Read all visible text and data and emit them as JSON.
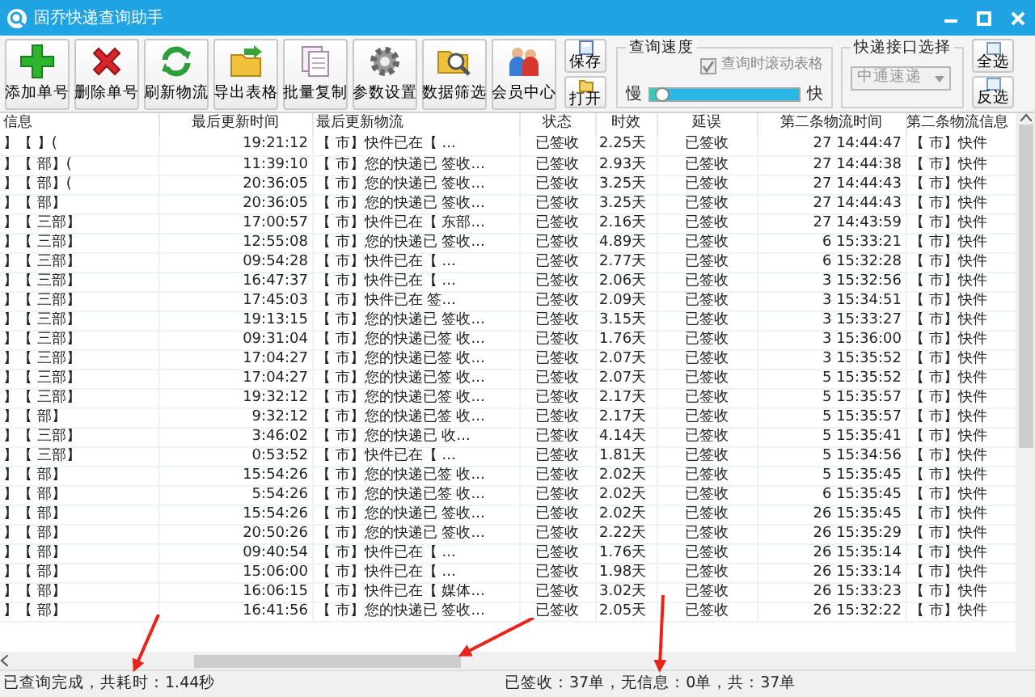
{
  "window": {
    "title": "固乔快递查询助手"
  },
  "toolbar": {
    "buttons": [
      {
        "label": "添加单号",
        "kind": "add"
      },
      {
        "label": "删除单号",
        "kind": "delete"
      },
      {
        "label": "刷新物流",
        "kind": "refresh"
      },
      {
        "label": "导出表格",
        "kind": "export"
      },
      {
        "label": "批量复制",
        "kind": "copy"
      },
      {
        "label": "参数设置",
        "kind": "settings"
      },
      {
        "label": "数据筛选",
        "kind": "filter"
      },
      {
        "label": "会员中心",
        "kind": "members"
      }
    ],
    "side_buttons": [
      {
        "label": "保存",
        "kind": "save"
      },
      {
        "label": "打开",
        "kind": "open"
      }
    ]
  },
  "speed": {
    "title": "查询速度",
    "scroll_checkbox": {
      "label": "查询时滚动表格",
      "checked": true,
      "disabled": true
    },
    "slow_label": "慢",
    "fast_label": "快",
    "level": 0.05
  },
  "interface": {
    "title": "快递接口选择",
    "value": "中通速递",
    "disabled": true
  },
  "select_buttons": [
    {
      "label": "全选"
    },
    {
      "label": "反选"
    }
  ],
  "table": {
    "columns": [
      "信息",
      "最后更新时间",
      "最后更新物流",
      "状态",
      "时效",
      "延误",
      "第二条物流时间",
      "第二条物流信息"
    ],
    "rows": [
      {
        "cells": [
          "】【 】(",
          "19:21:12",
          "【 市】快件已在【 ...",
          "已签收",
          "2.25天",
          "已签收",
          "27 14:44:47",
          "【 市】快件"
        ]
      },
      {
        "cells": [
          "】【 部】(",
          "11:39:10",
          "【 市】您的快递已 签收...",
          "已签收",
          "2.93天",
          "已签收",
          "27 14:44:38",
          "【 市】快件"
        ]
      },
      {
        "cells": [
          "】【 部】(",
          "20:36:05",
          "【 市】您的快递已 签收...",
          "已签收",
          "3.25天",
          "已签收",
          "27 14:44:43",
          "【 市】快件"
        ]
      },
      {
        "cells": [
          "】【 部】",
          "20:36:05",
          "【 市】您的快递已 签收...",
          "已签收",
          "3.25天",
          "已签收",
          "27 14:44:43",
          "【 市】快件"
        ]
      },
      {
        "cells": [
          "】【 三部】",
          "17:00:57",
          "【 市】快件已在【 东部...",
          "已签收",
          "2.16天",
          "已签收",
          "27 14:43:59",
          "【 市】快件"
        ]
      },
      {
        "cells": [
          "】【 三部】",
          "12:55:08",
          "【 市】您的快递已 签收...",
          "已签收",
          "4.89天",
          "已签收",
          "6 15:33:21",
          "【 市】快件"
        ]
      },
      {
        "cells": [
          "】【 三部】",
          "09:54:28",
          "【 市】快件已在【 ...",
          "已签收",
          "2.77天",
          "已签收",
          "6 15:32:28",
          "【 市】快件"
        ]
      },
      {
        "cells": [
          "】【 三部】",
          "16:47:37",
          "【 市】快件已在【 ...",
          "已签收",
          "2.06天",
          "已签收",
          "3 15:32:56",
          "【 市】快件"
        ]
      },
      {
        "cells": [
          "】【 三部】",
          "17:45:03",
          "【 市】快件已在 签...",
          "已签收",
          "2.09天",
          "已签收",
          "3 15:34:51",
          "【 市】快件"
        ]
      },
      {
        "cells": [
          "】【 三部】",
          "19:13:15",
          "【 市】您的快递已 签收...",
          "已签收",
          "3.15天",
          "已签收",
          "3 15:33:27",
          "【 市】快件"
        ]
      },
      {
        "cells": [
          "】【 三部】",
          "09:31:04",
          "【 市】您的快递已签 收...",
          "已签收",
          "1.76天",
          "已签收",
          "3 15:36:00",
          "【 市】快件"
        ]
      },
      {
        "cells": [
          "】【 三部】",
          "17:04:27",
          "【 市】您的快递已签 收...",
          "已签收",
          "2.07天",
          "已签收",
          "3 15:35:52",
          "【 市】快件"
        ]
      },
      {
        "cells": [
          "】【 三部】",
          "17:04:27",
          "【 市】您的快递已签 收...",
          "已签收",
          "2.07天",
          "已签收",
          "5 15:35:52",
          "【 市】快件"
        ]
      },
      {
        "cells": [
          "】【 三部】",
          "19:32:12",
          "【 市】您的快递已签 收...",
          "已签收",
          "2.17天",
          "已签收",
          "5 15:35:57",
          "【 市】快件"
        ]
      },
      {
        "cells": [
          "】【 部】",
          "9:32:12",
          "【 市】您的快递已签 收...",
          "已签收",
          "2.17天",
          "已签收",
          "5 15:35:57",
          "【 市】快件"
        ]
      },
      {
        "cells": [
          "】【 三部】",
          "3:46:02",
          "【 市】您的快递已 收...",
          "已签收",
          "4.14天",
          "已签收",
          "5 15:35:41",
          "【 市】快件"
        ]
      },
      {
        "cells": [
          "】【 三部】",
          "0:53:52",
          "【 市】快件已在【 ...",
          "已签收",
          "1.81天",
          "已签收",
          "5 15:34:56",
          "【 市】快件"
        ]
      },
      {
        "cells": [
          "】【 部】",
          "15:54:26",
          "【 市】您的快递已签 收...",
          "已签收",
          "2.02天",
          "已签收",
          "5 15:35:45",
          "【 市】快件"
        ]
      },
      {
        "cells": [
          "】【 部】",
          "5:54:26",
          "【 市】您的快递已签 收...",
          "已签收",
          "2.02天",
          "已签收",
          "6 15:35:45",
          "【 市】快件"
        ]
      },
      {
        "cells": [
          "】【 部】",
          "15:54:26",
          "【 市】您的快递已 签收...",
          "已签收",
          "2.02天",
          "已签收",
          "26 15:35:45",
          "【 市】快件"
        ]
      },
      {
        "cells": [
          "】【 部】",
          "20:50:26",
          "【 市】您的快递已 签收...",
          "已签收",
          "2.22天",
          "已签收",
          "26 15:35:29",
          "【 市】快件"
        ]
      },
      {
        "cells": [
          "】【 部】",
          "09:40:54",
          "【 市】快件已在【 ...",
          "已签收",
          "1.76天",
          "已签收",
          "26 15:35:14",
          "【 市】快件"
        ]
      },
      {
        "cells": [
          "】【 部】",
          "15:06:00",
          "【 市】快件已在【 ...",
          "已签收",
          "1.98天",
          "已签收",
          "26 15:33:14",
          "【 市】快件"
        ]
      },
      {
        "cells": [
          "】【 部】",
          "16:06:15",
          "【 市】快件已在【 媒体...",
          "已签收",
          "3.02天",
          "已签收",
          "26 15:33:23",
          "【 市】快件"
        ]
      },
      {
        "cells": [
          "】【 部】",
          "16:41:56",
          "【 市】您的快递已 签收...",
          "已签收",
          "2.05天",
          "已签收",
          "26 15:32:22",
          "【 市】快件"
        ]
      }
    ]
  },
  "status_bar": {
    "left": "已查询完成，共耗时：1.44秒",
    "right": "已签收：37单，无信息：0单，共：37单"
  }
}
